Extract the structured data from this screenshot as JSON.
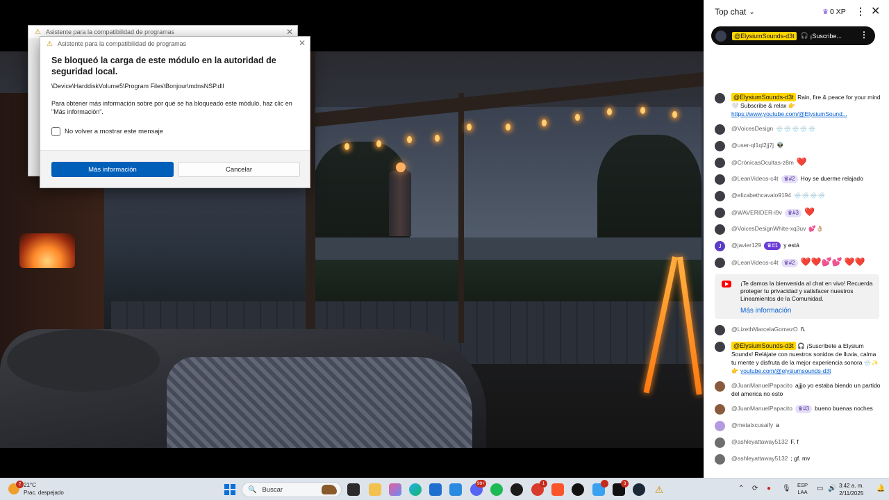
{
  "back_dialog": {
    "title": "Asistente para la compatibilidad de programas"
  },
  "dialog": {
    "title": "Asistente para la compatibilidad de programas",
    "heading": "Se bloqueó la carga de este módulo en la autoridad de seguridad local.",
    "path": "\\Device\\HarddiskVolume5\\Program Files\\Bonjour\\mdnsNSP.dll",
    "info": "Para obtener más información sobre por qué se ha bloqueado este módulo, haz clic en \"Más información\".",
    "checkbox_label": "No volver a mostrar este mensaje",
    "primary_button": "Más información",
    "secondary_button": "Cancelar"
  },
  "chat": {
    "title": "Top chat",
    "xp": "0 XP",
    "pinned": {
      "author": "@ElysiumSounds-d3t",
      "text": "¡Suscribe..."
    },
    "messages": [
      {
        "author": "@ElysiumSounds-d3t",
        "owner": true,
        "text": "Rain, fire & peace for your mind 🤍 Subscribe & relax 👉",
        "link": "https://www.youtube.com/@ElysiumSound..."
      },
      {
        "author": "@VoicesDesign",
        "emoji": "🌧️🌧️🌧️🌧️🌧️"
      },
      {
        "author": "@user-ql1ql2jj7j",
        "emoji": "👽"
      },
      {
        "author": "@CrónicasOcultas-z8m",
        "hearts": "❤️"
      },
      {
        "author": "@LeanVideos-c4t",
        "badge": "#2",
        "text": "Hoy se duerme relajado"
      },
      {
        "author": "@elizabethcavalo9194",
        "emoji": "🌧️🌧️🌧️🌧️"
      },
      {
        "author": "@WAVERIDER-i9v",
        "badge": "#3",
        "hearts": "❤️"
      },
      {
        "author": "@VoicesDesignWhite-xq3uv",
        "emoji": "💕👌🏼"
      },
      {
        "author": "@javier129",
        "badge": "#1",
        "badge_dark": true,
        "text": "y está",
        "initial": "J"
      },
      {
        "author": "@LeanVideos-c4t",
        "badge": "#2",
        "hearts": "❤️❤️💕💕 ❤️❤️"
      }
    ],
    "welcome": {
      "text": "¡Te damos la bienvenida al chat en vivo! Recuerda proteger tu privacidad y satisfacer nuestros Lineamientos de la Comunidad.",
      "link": "Más información"
    },
    "messages2": [
      {
        "author": "@LizethMarcelaGomezO",
        "text": "ñ."
      },
      {
        "author": "@ElysiumSounds-d3t",
        "owner": true,
        "text": "🎧 ¡Suscríbete a Elysium Sounds! Relájate con nuestros sonidos de lluvia, calma tu mente y disfruta de la mejor experiencia sonora 🌧️✨👉",
        "link": "youtube.com/@elysiumsounds-d3t"
      },
      {
        "author": "@JuanManuelPapacito",
        "text": "ajjjo yo estaba biendo un partido del america no esto"
      },
      {
        "author": "@JuanManuelPapacito",
        "badge": "#3",
        "text": "bueno buenas noches"
      },
      {
        "author": "@metalxcusaify",
        "text": "a"
      },
      {
        "author": "@ashleyattaway5132",
        "text": "F, f"
      },
      {
        "author": "@ashleyattaway5132",
        "text": "; gf. mv"
      }
    ]
  },
  "taskbar": {
    "temperature": "21°C",
    "weather": "Prac. despejado",
    "weather_badge": "2",
    "search_placeholder": "Buscar",
    "badge_99": "99+",
    "badge_1": "1",
    "badge_tiktok": "3",
    "lang1": "ESP",
    "lang2": "LAA",
    "time": "3:42 a. m.",
    "date": "2/11/2025"
  },
  "colors": {
    "accent": "#005fb8",
    "owner_tag": "#ffd600",
    "member_badge": "#e7def8",
    "link": "#065fd4"
  }
}
